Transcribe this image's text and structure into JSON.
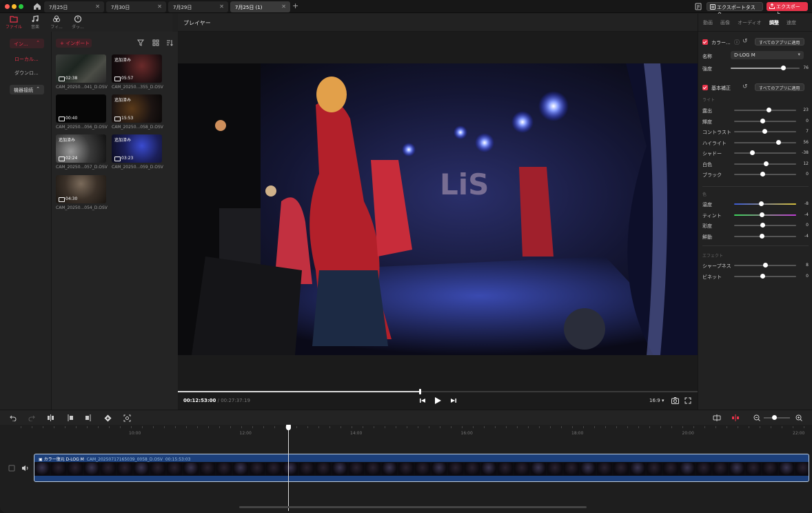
{
  "tabs": [
    {
      "label": "7月25日"
    },
    {
      "label": "7月30日"
    },
    {
      "label": "7月29日"
    },
    {
      "label": "7月25日 (1)"
    }
  ],
  "toolbar": {
    "export_task": "エクスポートタスク",
    "export": "エクスポート"
  },
  "left_tools": [
    {
      "label": "ファイル",
      "icon": "folder-icon"
    },
    {
      "label": "音楽",
      "icon": "music-icon"
    },
    {
      "label": "フィ...",
      "icon": "filter-icon"
    },
    {
      "label": "ダッ...",
      "icon": "dashboard-icon"
    }
  ],
  "sidebar": {
    "import_group": "イン...",
    "local": "ローカル...",
    "download": "ダウンロ...",
    "device": "機器接続"
  },
  "media": {
    "import_label": "+ インポート",
    "items": [
      {
        "name": "CAM_20250...041_D.OSV",
        "duration": "02:38",
        "added": ""
      },
      {
        "name": "CAM_20250...355_D.OSV",
        "duration": "05:57",
        "added": "追加済み"
      },
      {
        "name": "CAM_20250...056_D.OSV",
        "duration": "00:40",
        "added": ""
      },
      {
        "name": "CAM_20250...058_D.OSV",
        "duration": "15:53",
        "added": "追加済み"
      },
      {
        "name": "CAM_20250...057_D.OSV",
        "duration": "02:24",
        "added": "追加済み"
      },
      {
        "name": "CAM_20250...059_D.OSV",
        "duration": "03:23",
        "added": "追加済み"
      },
      {
        "name": "CAM_20250...054_D.OSV",
        "duration": "04:30",
        "added": ""
      }
    ]
  },
  "player": {
    "title": "プレイヤー",
    "current_time": "00:12:53:00",
    "total_time": "/ 00:27:37:19",
    "progress": 0.466,
    "ratio": "16:9 ▾"
  },
  "right_panel": {
    "tabs": [
      "動画",
      "画像",
      "オーディオ",
      "調整",
      "速度"
    ],
    "active_tab": "調整",
    "color_title": "カラー...",
    "apply_all": "すべてのアプリに適用",
    "name_label": "名称",
    "name_value": "D-LOG M",
    "strength_label": "強度",
    "strength_value": "76",
    "strength_pct": 0.76,
    "basic_title": "基本補正",
    "light_section": "ライト",
    "light": [
      {
        "label": "露出",
        "value": "23",
        "pos": 0.56
      },
      {
        "label": "輝度",
        "value": "0",
        "pos": 0.46
      },
      {
        "label": "コントラスト",
        "value": "7",
        "pos": 0.49
      },
      {
        "label": "ハイライト",
        "value": "56",
        "pos": 0.71
      },
      {
        "label": "シャドー",
        "value": "-38",
        "pos": 0.29
      },
      {
        "label": "白色",
        "value": "12",
        "pos": 0.51
      },
      {
        "label": "ブラック",
        "value": "0",
        "pos": 0.46
      }
    ],
    "color_section": "色",
    "color": [
      {
        "label": "温度",
        "value": "-8",
        "pos": 0.43,
        "grad": "linear-gradient(90deg,#3b5bd6,#888,#d6c03b)"
      },
      {
        "label": "ティント",
        "value": "-4",
        "pos": 0.44,
        "grad": "linear-gradient(90deg,#3bd65b,#888,#c03bd6)"
      },
      {
        "label": "彩度",
        "value": "0",
        "pos": 0.46,
        "grad": ""
      },
      {
        "label": "鮮動",
        "value": "-4",
        "pos": 0.44,
        "grad": ""
      }
    ],
    "effect_section": "エフェクト",
    "effect": [
      {
        "label": "シャープネス",
        "value": "8",
        "pos": 0.5
      },
      {
        "label": "ビネット",
        "value": "0",
        "pos": 0.46
      }
    ]
  },
  "timeline": {
    "times": [
      "10:00",
      "12:00",
      "14:00",
      "16:00",
      "18:00",
      "20:00",
      "22:00"
    ],
    "clip_effect": "カラー復元 D-LOG M",
    "clip_file": "CAM_20250717165039_0058_D.OSV",
    "clip_duration": "00:15:53:03"
  },
  "colors": {
    "accent": "#e8334a",
    "clip": "#1c3f7a"
  }
}
